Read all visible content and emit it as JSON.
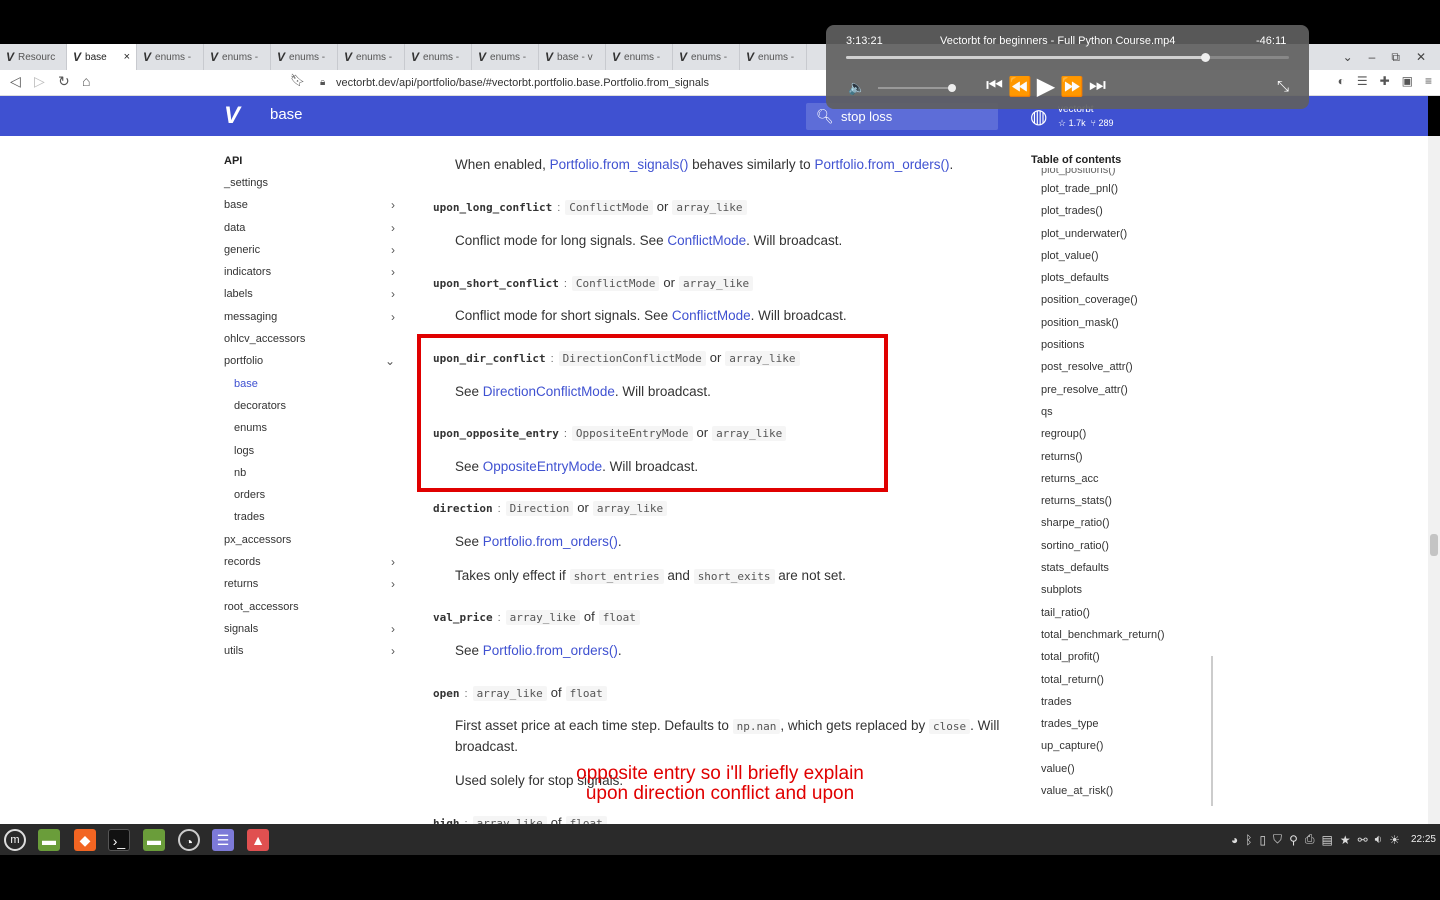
{
  "browser": {
    "tabs": [
      {
        "label": "Resourc",
        "active": false
      },
      {
        "label": "base",
        "active": true
      },
      {
        "label": "enums -",
        "active": false
      },
      {
        "label": "enums -",
        "active": false
      },
      {
        "label": "enums -",
        "active": false
      },
      {
        "label": "enums -",
        "active": false
      },
      {
        "label": "enums -",
        "active": false
      },
      {
        "label": "enums -",
        "active": false
      },
      {
        "label": "base - v",
        "active": false
      },
      {
        "label": "enums -",
        "active": false
      },
      {
        "label": "enums -",
        "active": false
      },
      {
        "label": "enums -",
        "active": false
      }
    ],
    "tab_logo": "V",
    "tab_close": "×",
    "url": "vectorbt.dev/api/portfolio/base/#vectorbt.portfolio.base.Portfolio.from_signals"
  },
  "site": {
    "logo": "V",
    "title": "base",
    "search_value": "stop loss",
    "repo_name": "vectorbt",
    "repo_stars": "☆ 1.7k",
    "repo_forks": "⑂ 289",
    "header_color": "#3f51d1"
  },
  "left_nav": {
    "heading": "API",
    "items": [
      {
        "label": "_settings",
        "chevron": ""
      },
      {
        "label": "base",
        "chevron": "›"
      },
      {
        "label": "data",
        "chevron": "›"
      },
      {
        "label": "generic",
        "chevron": "›"
      },
      {
        "label": "indicators",
        "chevron": "›"
      },
      {
        "label": "labels",
        "chevron": "›"
      },
      {
        "label": "messaging",
        "chevron": "›"
      },
      {
        "label": "ohlcv_accessors",
        "chevron": ""
      },
      {
        "label": "portfolio",
        "chevron": "⌄"
      },
      {
        "label": "base",
        "chevron": ""
      },
      {
        "label": "decorators",
        "chevron": ""
      },
      {
        "label": "enums",
        "chevron": ""
      },
      {
        "label": "logs",
        "chevron": ""
      },
      {
        "label": "nb",
        "chevron": ""
      },
      {
        "label": "orders",
        "chevron": ""
      },
      {
        "label": "trades",
        "chevron": ""
      },
      {
        "label": "px_accessors",
        "chevron": ""
      },
      {
        "label": "records",
        "chevron": "›"
      },
      {
        "label": "returns",
        "chevron": "›"
      },
      {
        "label": "root_accessors",
        "chevron": ""
      },
      {
        "label": "signals",
        "chevron": "›"
      },
      {
        "label": "utils",
        "chevron": "›"
      }
    ]
  },
  "content": {
    "intro": {
      "pre": "When enabled, ",
      "link1": "Portfolio.from_signals()",
      "mid": " behaves similarly to ",
      "link2": "Portfolio.from_orders()",
      "post": "."
    },
    "sep": ":",
    "or": "or",
    "of": "of",
    "p1": {
      "name": "upon_long_conflict",
      "type1": "ConflictMode",
      "type2": "array_like",
      "pre": "Conflict mode for long signals. See ",
      "link": "ConflictMode",
      "post": ". Will broadcast."
    },
    "p2": {
      "name": "upon_short_conflict",
      "type1": "ConflictMode",
      "type2": "array_like",
      "pre": "Conflict mode for short signals. See ",
      "link": "ConflictMode",
      "post": ". Will broadcast."
    },
    "p3": {
      "name": "upon_dir_conflict",
      "type1": "DirectionConflictMode",
      "type2": "array_like",
      "pre": "See ",
      "link": "DirectionConflictMode",
      "post": ". Will broadcast."
    },
    "p4": {
      "name": "upon_opposite_entry",
      "type1": "OppositeEntryMode",
      "type2": "array_like",
      "pre": "See ",
      "link": "OppositeEntryMode",
      "post": ". Will broadcast."
    },
    "p5": {
      "name": "direction",
      "type1": "Direction",
      "type2": "array_like",
      "pre": "See ",
      "link": "Portfolio.from_orders()",
      "post": ".",
      "note_pre": "Takes only effect if ",
      "note_code1": "short_entries",
      "note_and": " and ",
      "note_code2": "short_exits",
      "note_post": " are not set."
    },
    "p6": {
      "name": "val_price",
      "type1": "array_like",
      "type2": "float",
      "pre": "See ",
      "link": "Portfolio.from_orders()",
      "post": "."
    },
    "p7": {
      "name": "open",
      "type1": "array_like",
      "type2": "float",
      "desc_pre": "First asset price at each time step. Defaults to ",
      "desc_code1": "np.nan",
      "desc_mid": ", which gets replaced by ",
      "desc_code2": "close",
      "desc_post": ". Will",
      "desc_line2": "broadcast.",
      "note": "Used solely for stop signals."
    },
    "p8": {
      "name": "high",
      "type1": "array_like",
      "type2": "float"
    }
  },
  "toc": {
    "title": "Table of contents",
    "items": [
      "plot_positions()",
      "plot_trade_pnl()",
      "plot_trades()",
      "plot_underwater()",
      "plot_value()",
      "plots_defaults",
      "position_coverage()",
      "position_mask()",
      "positions",
      "post_resolve_attr()",
      "pre_resolve_attr()",
      "qs",
      "regroup()",
      "returns()",
      "returns_acc",
      "returns_stats()",
      "sharpe_ratio()",
      "sortino_ratio()",
      "stats_defaults",
      "subplots",
      "tail_ratio()",
      "total_benchmark_return()",
      "total_profit()",
      "total_return()",
      "trades",
      "trades_type",
      "up_capture()",
      "value()",
      "value_at_risk()"
    ]
  },
  "subtitles": {
    "line1": "opposite entry so i'll briefly explain",
    "line2": "upon direction conflict and upon",
    "color": "#e00000"
  },
  "video": {
    "elapsed": "3:13:21",
    "title": "Vectorbt for beginners - Full Python Course.mp4",
    "remaining": "-46:11",
    "progress": 0.81,
    "volume_icon": "🔈",
    "controls": [
      "⏮",
      "⏪",
      "▶",
      "⏩",
      "⏭"
    ],
    "exit_icon": "⤡"
  },
  "taskbar": {
    "clock": "22:25"
  }
}
